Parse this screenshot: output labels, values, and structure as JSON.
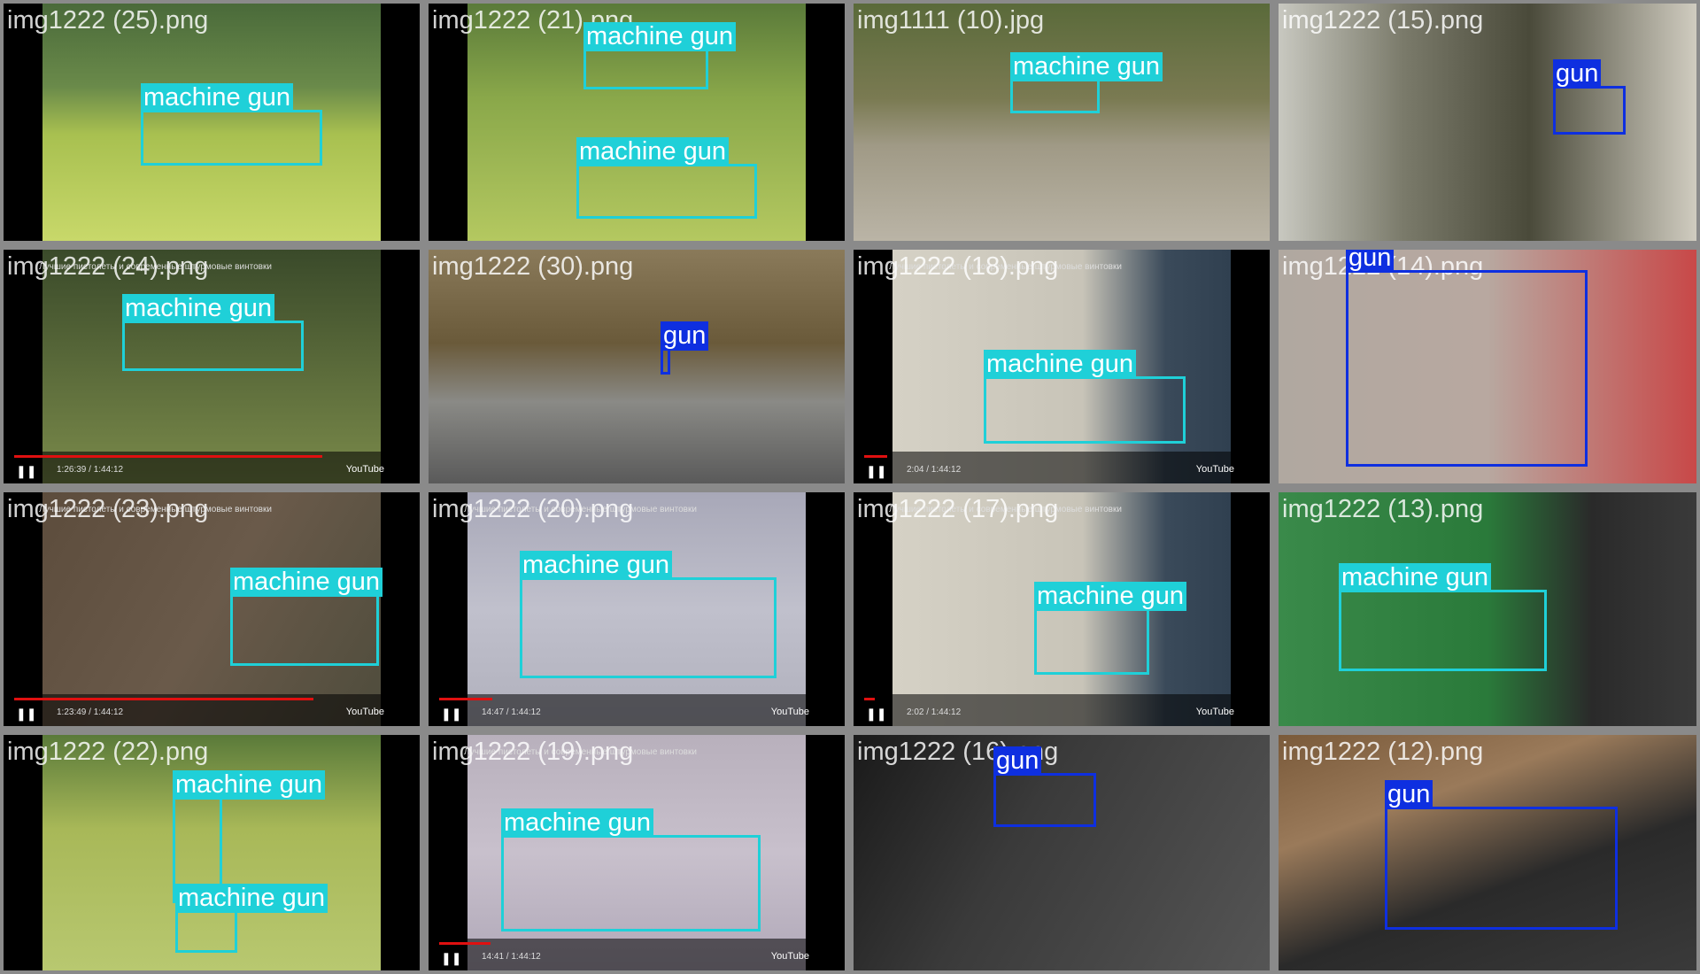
{
  "labels": {
    "machine_gun": "machine gun",
    "gun": "gun"
  },
  "colors": {
    "machine_gun": "#1fd0d8",
    "gun": "#0e2fe0",
    "background": "#8a8a8a"
  },
  "youtube": {
    "brand": "YouTube",
    "top_caption": "Лучшие пистолеты и современные штурмовые винтовки"
  },
  "tiles": [
    {
      "filename": "img1222 (25).png",
      "style": "field"
    },
    {
      "filename": "img1222 (21).png",
      "style": "field"
    },
    {
      "filename": "img1111 (10).jpg",
      "style": "dirt"
    },
    {
      "filename": "img1222 (15).png",
      "style": "indoor"
    },
    {
      "filename": "img1222 (24).png",
      "style": "forest",
      "youtube": {
        "time": "1:26:39 / 1:44:12",
        "progress": 0.82
      }
    },
    {
      "filename": "img1222 (30).png",
      "style": "road"
    },
    {
      "filename": "img1222 (18).png",
      "style": "room",
      "youtube": {
        "time": "2:04 / 1:44:12",
        "progress": 0.06
      }
    },
    {
      "filename": "img1222 (14).png",
      "style": "red"
    },
    {
      "filename": "img1222 (23).png",
      "style": "camo",
      "youtube": {
        "time": "1:23:49 / 1:44:12",
        "progress": 0.8
      }
    },
    {
      "filename": "img1222 (20).png",
      "style": "grey",
      "youtube": {
        "time": "14:47 / 1:44:12",
        "progress": 0.14
      }
    },
    {
      "filename": "img1222 (17).png",
      "style": "room",
      "youtube": {
        "time": "2:02 / 1:44:12",
        "progress": 0.05
      }
    },
    {
      "filename": "img1222 (13).png",
      "style": "hedge"
    },
    {
      "filename": "img1222 (22).png",
      "style": "field"
    },
    {
      "filename": "img1222 (19).png",
      "style": "grey",
      "youtube": {
        "time": "14:41 / 1:44:12",
        "progress": 0.14
      }
    },
    {
      "filename": "img1222 (16).png",
      "style": "dark"
    },
    {
      "filename": "img1222 (12).png",
      "style": "wood"
    }
  ]
}
